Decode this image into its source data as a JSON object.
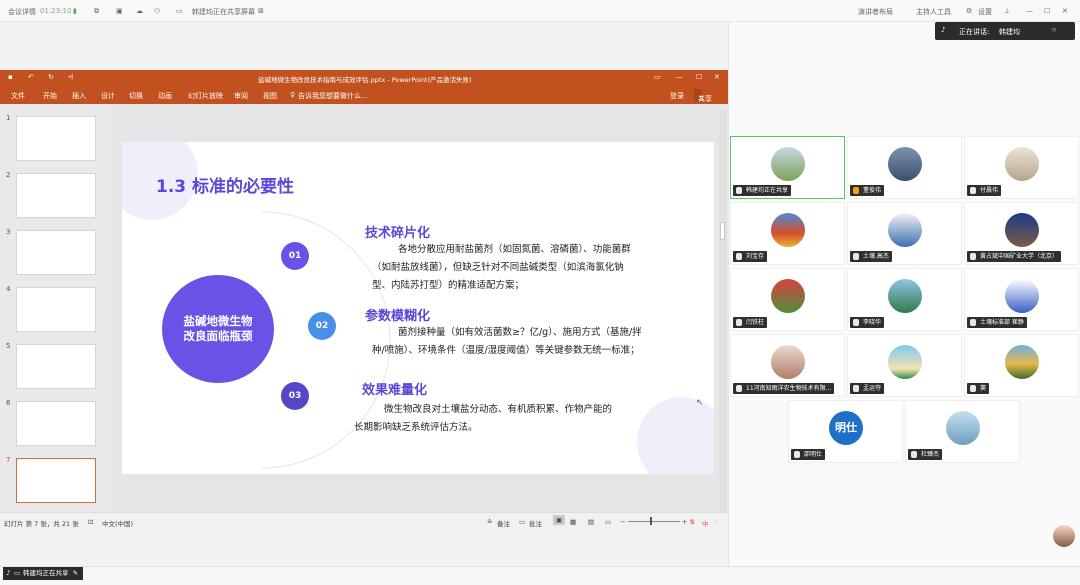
{
  "topbar": {
    "meeting_details": "会议详情",
    "timer": "01:23:10",
    "sharing_notice": "韩建均正在共享屏幕",
    "speaker_view": "演讲者布局",
    "host_label": "主持人工具",
    "settings": "设置"
  },
  "speaking": {
    "label": "正在讲话:",
    "name": "韩建均"
  },
  "ppt": {
    "title": "盐碱地微生物改良技术指南与成效评估.pptx - PowerPoint(产品激活失败)",
    "tabs": [
      "文件",
      "开始",
      "插入",
      "设计",
      "切换",
      "动画",
      "幻灯片放映",
      "审阅",
      "视图"
    ],
    "tell_me": "告诉我您想要做什么...",
    "login": "登录",
    "share": "共享",
    "thumb_numbers": [
      "1",
      "2",
      "3",
      "4",
      "5",
      "6",
      "7"
    ],
    "status_slide": "幻灯片 第 7 张，共 21 张",
    "status_lang": "中文(中国)",
    "status_notes": "备注",
    "status_comments": "批注"
  },
  "slide": {
    "title": "1.3 标准的必要性",
    "center": [
      "盐碱地微生物",
      "改良面临瓶颈"
    ],
    "numbers": [
      "01",
      "02",
      "03"
    ],
    "sections": [
      {
        "heading": "技术碎片化",
        "lines": [
          "各地分散应用耐盐菌剂（如固氮菌、溶磷菌）、功能菌群",
          "（如耐盐放线菌），但缺乏针对不同盐碱类型（如滨海氯化钠",
          "型、内陆苏打型）的精准适配方案；"
        ]
      },
      {
        "heading": "参数模糊化",
        "lines": [
          "菌剂接种量（如有效活菌数≥？亿/g）、施用方式（基施/拌",
          "种/喷施）、环境条件（温度/湿度阈值）等关键参数无统一标准；"
        ]
      },
      {
        "heading": "效果难量化",
        "lines": [
          "微生物改良对土壤盐分动态、有机质积累、作物产能的",
          "长期影响缺乏系统评估方法。"
        ]
      }
    ]
  },
  "participants": [
    {
      "name": "韩建均正在共享"
    },
    {
      "name": "董俊伟"
    },
    {
      "name": "付晨伟"
    },
    {
      "name": "刘宝存"
    },
    {
      "name": "土壤.高杰"
    },
    {
      "name": "黄占斌中国矿业大学（北京）"
    },
    {
      "name": "闫铁柱"
    },
    {
      "name": "李晓华"
    },
    {
      "name": "土壤标准部 崔静"
    },
    {
      "name": "11河南知雨洋农生物技术有限..."
    },
    {
      "name": "孟运夺"
    },
    {
      "name": "窦"
    },
    {
      "name": "邵明仕",
      "avatar_text": "明仕"
    },
    {
      "name": "杜臻杰"
    }
  ],
  "bottom_notice": "韩建均正在共享",
  "colors": {
    "ppt_orange": "#c3501f",
    "accent_purple": "#6b52e6",
    "accent_blue": "#4a8fe7"
  }
}
